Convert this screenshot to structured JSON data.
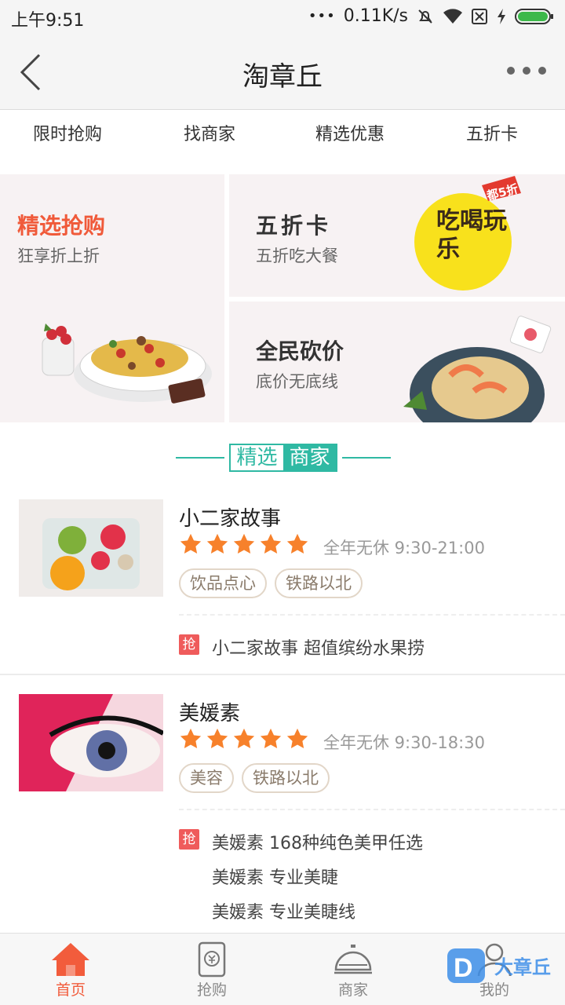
{
  "status_bar": {
    "time": "上午9:51",
    "speed": "0.11K/s",
    "dots": "•••"
  },
  "header": {
    "title": "淘章丘"
  },
  "tabs": [
    "限时抢购",
    "找商家",
    "精选优惠",
    "五折卡"
  ],
  "promo": {
    "card1": {
      "title": "精选抢购",
      "subtitle": "狂享折上折",
      "title_color": "#f05a3a"
    },
    "card2": {
      "title": "五折卡",
      "subtitle": "五折吃大餐",
      "badge_main": "吃喝玩乐",
      "badge_corner": "都5折"
    },
    "card3": {
      "title": "全民砍价",
      "subtitle": "底价无底线"
    }
  },
  "section": {
    "word1": "精选",
    "word2": "商家",
    "accent": "#2fb9a3"
  },
  "merchants": [
    {
      "name": "小二家故事",
      "rating": 5,
      "hours": "全年无休 9:30-21:00",
      "tags": [
        "饮品点心",
        "铁路以北"
      ],
      "deal_badge": "抢",
      "deals": [
        "小二家故事 超值缤纷水果捞"
      ]
    },
    {
      "name": "美媛素",
      "rating": 5,
      "hours": "全年无休 9:30-18:30",
      "tags": [
        "美容",
        "铁路以北"
      ],
      "deal_badge": "抢",
      "deals": [
        "美媛素 168种纯色美甲任选",
        "美媛素 专业美睫",
        "美媛素 专业美睫线"
      ]
    }
  ],
  "bottom_nav": [
    {
      "label": "首页",
      "icon": "home-icon",
      "active": true
    },
    {
      "label": "抢购",
      "icon": "ticket-icon",
      "active": false
    },
    {
      "label": "商家",
      "icon": "service-bell-icon",
      "active": false
    },
    {
      "label": "我的",
      "icon": "user-icon",
      "active": false
    }
  ],
  "watermark": {
    "text": "大章丘"
  },
  "colors": {
    "accent_orange": "#f25c3c",
    "star": "#f7812b",
    "teal": "#2fb9a3"
  }
}
